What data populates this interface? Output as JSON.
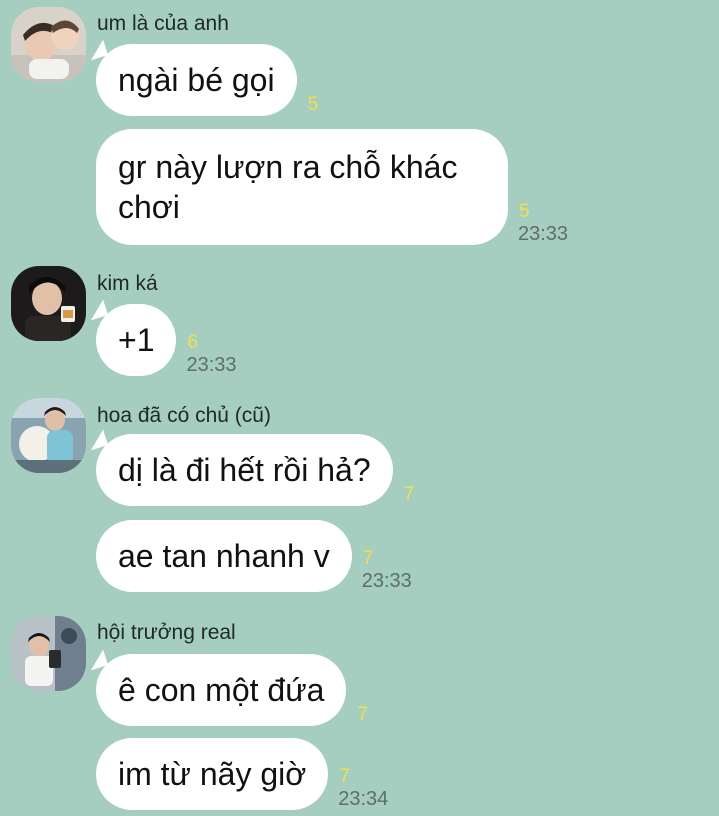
{
  "groups": [
    {
      "sender": "um là của anh",
      "avatar_icon": "profile-photo-icon",
      "messages": [
        {
          "text": "ngài bé gọi",
          "count": "5",
          "time": ""
        },
        {
          "text": "gr này lượn ra chỗ khác chơi",
          "count": "5",
          "time": "23:33"
        }
      ]
    },
    {
      "sender": "kim ká",
      "avatar_icon": "profile-photo-icon",
      "messages": [
        {
          "text": "+1",
          "count": "6",
          "time": "23:33"
        }
      ]
    },
    {
      "sender": "hoa đã có chủ (cũ)",
      "avatar_icon": "profile-photo-icon",
      "messages": [
        {
          "text": "dị là đi hết rồi hả?",
          "count": "7",
          "time": ""
        },
        {
          "text": "ae tan nhanh v",
          "count": "7",
          "time": "23:33"
        }
      ]
    },
    {
      "sender": "hội trưởng real",
      "avatar_icon": "profile-photo-icon",
      "messages": [
        {
          "text": "ê con một đứa",
          "count": "7",
          "time": ""
        },
        {
          "text": "im từ nãy giờ",
          "count": "7",
          "time": "23:34"
        }
      ]
    }
  ],
  "colors": {
    "background": "#a5cdc0",
    "bubble": "#ffffff",
    "read_count": "#f1e04a",
    "timestamp": "#5e6e68"
  }
}
